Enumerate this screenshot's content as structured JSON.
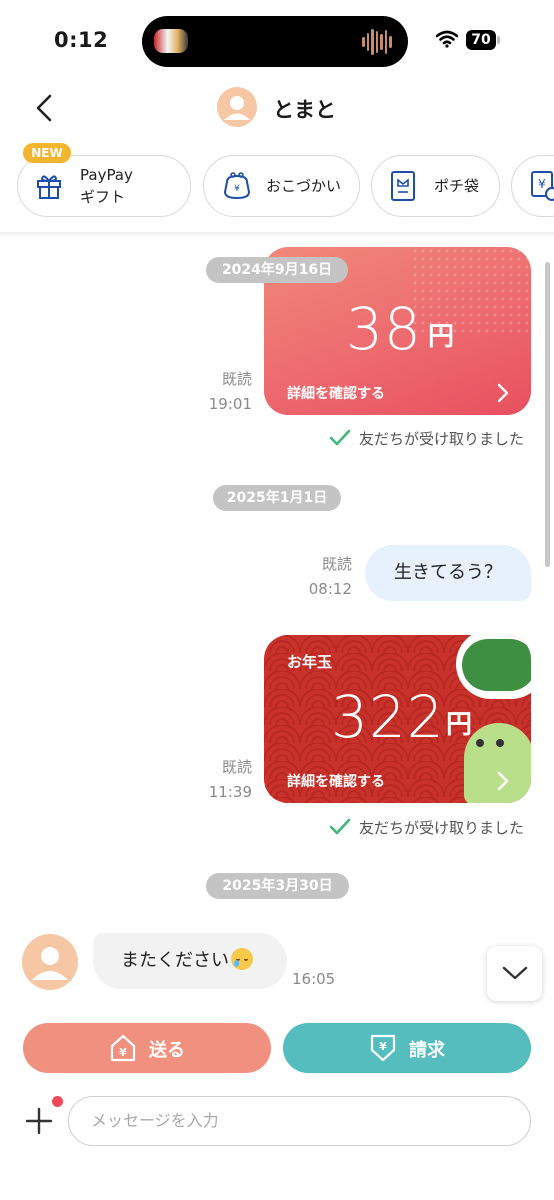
{
  "status_bar": {
    "time": "0:12",
    "battery": "70"
  },
  "header": {
    "title": "とまと"
  },
  "quick_actions": {
    "new_badge": "NEW",
    "items": [
      {
        "label_line1": "PayPay",
        "label_line2": "ギフト",
        "icon": "gift-icon"
      },
      {
        "label": "おこづかい",
        "icon": "wallet-icon"
      },
      {
        "label": "ポチ袋",
        "icon": "envelope-icon"
      },
      {
        "label": "",
        "icon": "scheduled-payment-icon"
      }
    ]
  },
  "messages": {
    "date1": "2024年9月16日",
    "card1": {
      "amount": "38",
      "currency": "円",
      "link": "詳細を確認する",
      "read": "既読",
      "time": "19:01",
      "received": "友だちが受け取りました"
    },
    "date2": "2025年1月1日",
    "text1": {
      "text": "生きてるう？",
      "read": "既読",
      "time": "08:12"
    },
    "card2": {
      "title": "お年玉",
      "amount": "322",
      "currency": "円",
      "link": "詳細を確認する",
      "read": "既読",
      "time": "11:39",
      "received": "友だちが受け取りました"
    },
    "date3": "2025年3月30日",
    "incoming": {
      "text": "またください",
      "time": "16:05"
    }
  },
  "actions": {
    "send": "送る",
    "request": "請求"
  },
  "composer": {
    "placeholder": "メッセージを入力"
  },
  "colors": {
    "send": "#f0907e",
    "request": "#55bdbd",
    "card1": "#ef6b6b",
    "card2": "#c9312b"
  }
}
